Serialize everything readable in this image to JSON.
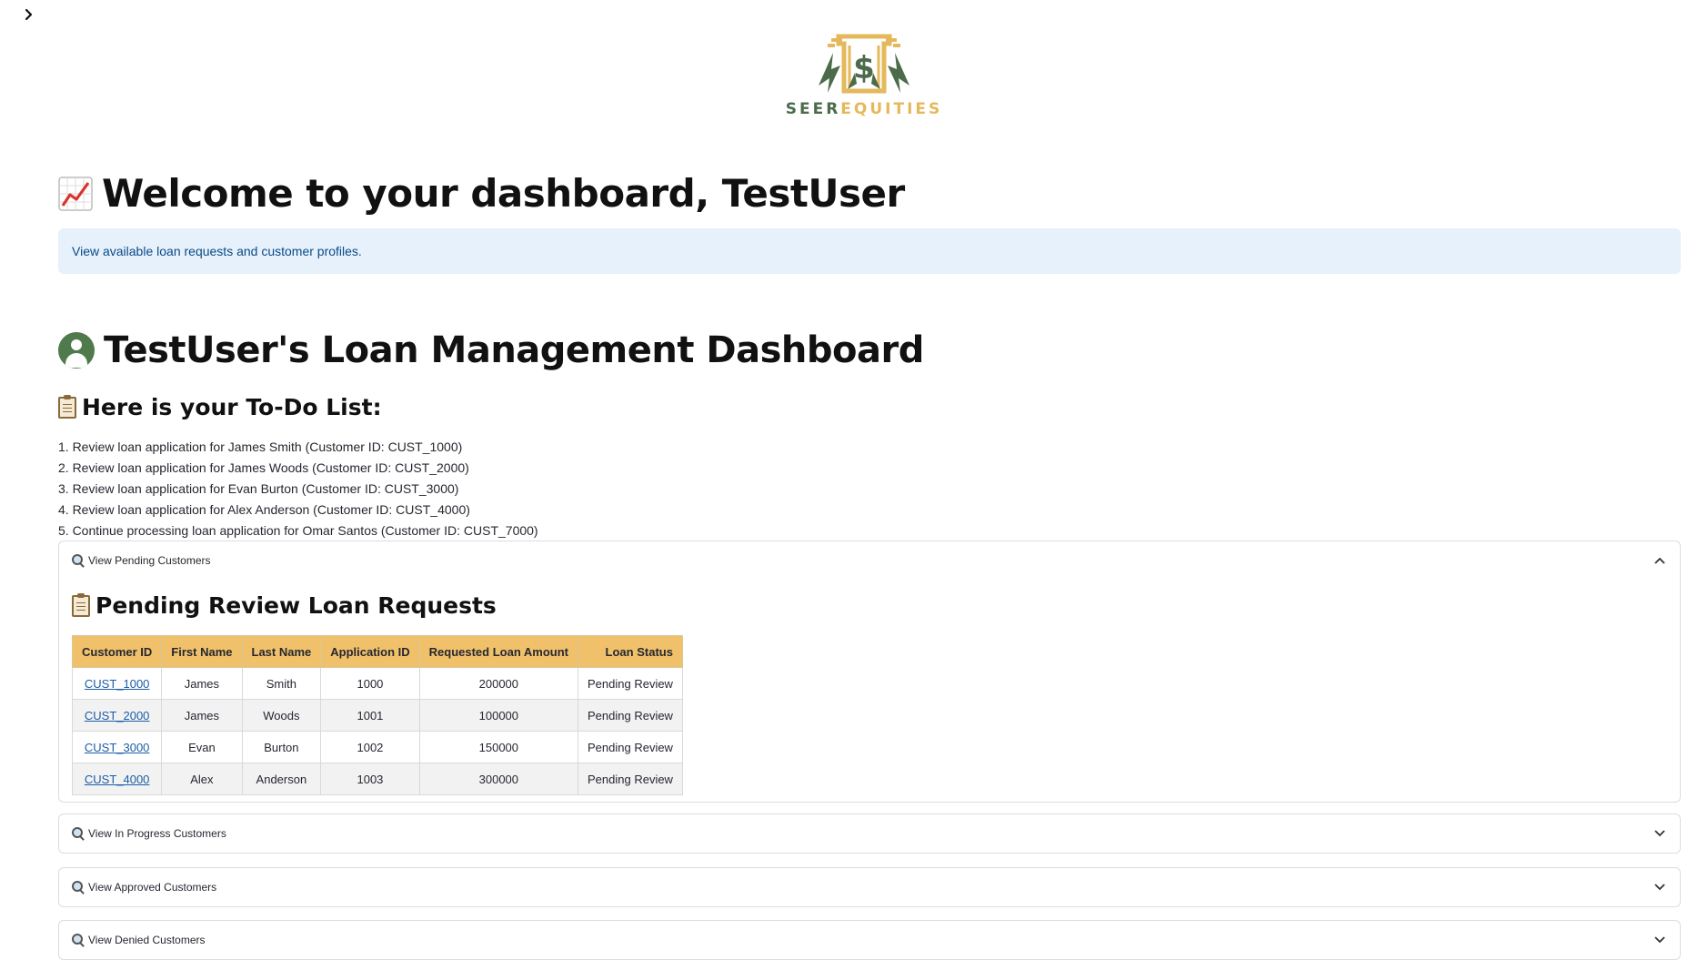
{
  "header": {
    "logo": {
      "text_primary": "SEER",
      "text_secondary": "EQUITIES",
      "colors": {
        "green": "#4c6b4a",
        "gold": "#e5b95b"
      }
    }
  },
  "welcome": {
    "icon": "chart-increasing-icon",
    "title": "Welcome to your dashboard, TestUser",
    "info": "View available loan requests and customer profiles."
  },
  "dashboard": {
    "title": "TestUser's Loan Management Dashboard",
    "todo_title": "Here is your To-Do List:",
    "todo": [
      "1. Review loan application for James Smith (Customer ID: CUST_1000)",
      "2. Review loan application for James Woods (Customer ID: CUST_2000)",
      "3. Review loan application for Evan Burton (Customer ID: CUST_3000)",
      "4. Review loan application for Alex Anderson (Customer ID: CUST_4000)",
      "5. Continue processing loan application for Omar Santos (Customer ID: CUST_7000)"
    ]
  },
  "expanders": [
    {
      "label": "View Pending Customers",
      "expanded": true
    },
    {
      "label": "View In Progress Customers",
      "expanded": false
    },
    {
      "label": "View Approved Customers",
      "expanded": false
    },
    {
      "label": "View Denied Customers",
      "expanded": false
    }
  ],
  "pending": {
    "title": "Pending Review Loan Requests",
    "columns": [
      "Customer ID",
      "First Name",
      "Last Name",
      "Application ID",
      "Requested Loan Amount",
      "Loan Status"
    ],
    "rows": [
      [
        "CUST_1000",
        "James",
        "Smith",
        "1000",
        "200000",
        "Pending Review"
      ],
      [
        "CUST_2000",
        "James",
        "Woods",
        "1001",
        "100000",
        "Pending Review"
      ],
      [
        "CUST_3000",
        "Evan",
        "Burton",
        "1002",
        "150000",
        "Pending Review"
      ],
      [
        "CUST_4000",
        "Alex",
        "Anderson",
        "1003",
        "300000",
        "Pending Review"
      ]
    ],
    "header_color": "#f0c16a"
  }
}
